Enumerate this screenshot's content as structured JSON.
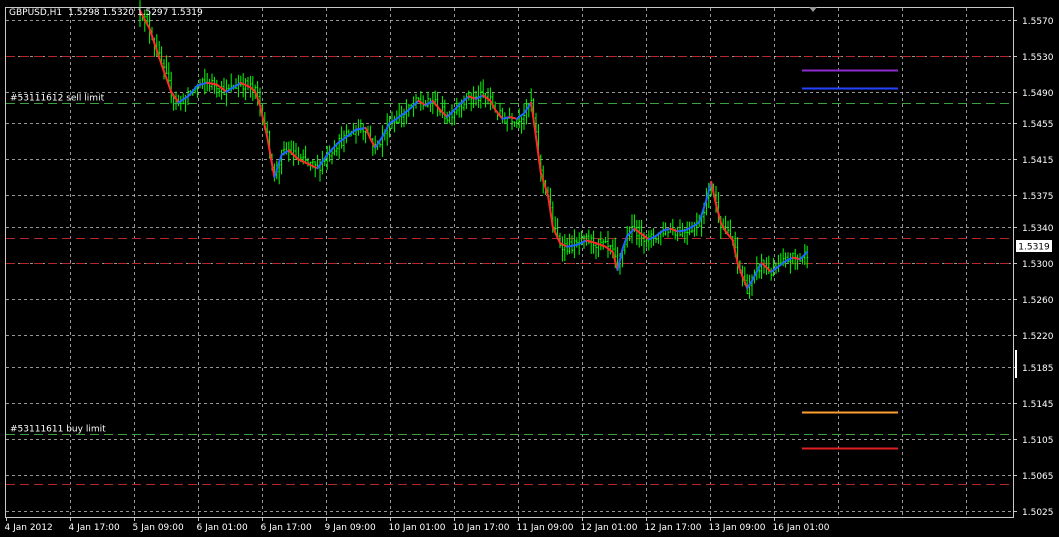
{
  "header": {
    "symbol_tf": "GBPUSD,H1",
    "ohlc": "1.5298 1.5320 1.5297 1.5319"
  },
  "current_price_label": "1.5319",
  "colors": {
    "background": "#000000",
    "grid": "#c8c8c8",
    "bull": "#00ff00",
    "bear": "#00ff00",
    "red_line": "#ff2a2a",
    "blue_line": "#1e64ff",
    "green_dash": "#3ca03c",
    "red_dash": "#b42828",
    "purple_seg": "#8e2bd0",
    "blue_seg": "#2244ff",
    "orange_seg": "#ff9e30",
    "red_seg": "#e02020"
  },
  "orders": [
    {
      "label": "#53111612 sell limit",
      "price": 1.5478,
      "color": "#3ca03c"
    },
    {
      "label": "#53111611 buy limit",
      "price": 1.511,
      "color": "#3ca03c"
    }
  ],
  "chart_data": {
    "type": "candlestick",
    "price_ticks": [
      "1.5570",
      "1.5530",
      "1.5490",
      "1.5455",
      "1.5415",
      "1.5375",
      "1.5340",
      "1.5300",
      "1.5260",
      "1.5220",
      "1.5185",
      "1.5145",
      "1.5105",
      "1.5065",
      "1.5025"
    ],
    "time_ticks": [
      "4 Jan 2012",
      "4 Jan 17:00",
      "5 Jan 09:00",
      "6 Jan 01:00",
      "6 Jan 17:00",
      "9 Jan 09:00",
      "10 Jan 01:00",
      "10 Jan 17:00",
      "11 Jan 09:00",
      "12 Jan 01:00",
      "12 Jan 17:00",
      "13 Jan 09:00",
      "16 Jan 01:00"
    ],
    "ylim": [
      1.5018,
      1.5583
    ],
    "red_dashed_levels": [
      1.553,
      1.5328,
      1.53,
      1.5055
    ],
    "level_segments": [
      {
        "price": 1.5514,
        "color": "#8e2bd0"
      },
      {
        "price": 1.5494,
        "color": "#2244ff"
      },
      {
        "price": 1.5135,
        "color": "#ff9e30"
      },
      {
        "price": 1.5095,
        "color": "#e02020"
      }
    ],
    "path_points": [
      [
        0,
        1.558
      ],
      [
        4,
        1.556
      ],
      [
        9,
        1.552
      ],
      [
        13,
        1.549
      ],
      [
        16,
        1.5478
      ],
      [
        20,
        1.5485
      ],
      [
        24,
        1.5497
      ],
      [
        28,
        1.55
      ],
      [
        32,
        1.5498
      ],
      [
        36,
        1.549
      ],
      [
        39,
        1.5495
      ],
      [
        42,
        1.55
      ],
      [
        46,
        1.5495
      ],
      [
        48,
        1.549
      ],
      [
        50,
        1.5475
      ],
      [
        53,
        1.544
      ],
      [
        56,
        1.5395
      ],
      [
        59,
        1.542
      ],
      [
        62,
        1.5425
      ],
      [
        66,
        1.5415
      ],
      [
        70,
        1.541
      ],
      [
        74,
        1.5405
      ],
      [
        78,
        1.542
      ],
      [
        82,
        1.5432
      ],
      [
        86,
        1.544
      ],
      [
        90,
        1.5448
      ],
      [
        94,
        1.545
      ],
      [
        96,
        1.5438
      ],
      [
        98,
        1.5428
      ],
      [
        101,
        1.544
      ],
      [
        104,
        1.5455
      ],
      [
        108,
        1.5462
      ],
      [
        112,
        1.547
      ],
      [
        116,
        1.548
      ],
      [
        119,
        1.5475
      ],
      [
        122,
        1.548
      ],
      [
        125,
        1.547
      ],
      [
        128,
        1.5462
      ],
      [
        131,
        1.547
      ],
      [
        134,
        1.5478
      ],
      [
        137,
        1.5485
      ],
      [
        140,
        1.5482
      ],
      [
        143,
        1.5486
      ],
      [
        146,
        1.548
      ],
      [
        148,
        1.547
      ],
      [
        151,
        1.546
      ],
      [
        154,
        1.5462
      ],
      [
        157,
        1.546
      ],
      [
        160,
        1.5466
      ],
      [
        163,
        1.5478
      ],
      [
        165,
        1.544
      ],
      [
        167,
        1.54
      ],
      [
        170,
        1.5375
      ],
      [
        172,
        1.534
      ],
      [
        175,
        1.5322
      ],
      [
        178,
        1.5318
      ],
      [
        182,
        1.532
      ],
      [
        186,
        1.5325
      ],
      [
        190,
        1.5322
      ],
      [
        194,
        1.5318
      ],
      [
        197,
        1.5312
      ],
      [
        199,
        1.5292
      ],
      [
        201,
        1.5315
      ],
      [
        203,
        1.533
      ],
      [
        206,
        1.5338
      ],
      [
        209,
        1.5332
      ],
      [
        212,
        1.5326
      ],
      [
        215,
        1.533
      ],
      [
        218,
        1.5336
      ],
      [
        221,
        1.5338
      ],
      [
        224,
        1.5335
      ],
      [
        227,
        1.5336
      ],
      [
        230,
        1.534
      ],
      [
        233,
        1.5345
      ],
      [
        236,
        1.537
      ],
      [
        238,
        1.539
      ],
      [
        240,
        1.5365
      ],
      [
        242,
        1.5345
      ],
      [
        244,
        1.5335
      ],
      [
        247,
        1.5325
      ],
      [
        249,
        1.53
      ],
      [
        251,
        1.5285
      ],
      [
        253,
        1.5272
      ],
      [
        255,
        1.528
      ],
      [
        257,
        1.529
      ],
      [
        259,
        1.53
      ],
      [
        261,
        1.5295
      ],
      [
        263,
        1.529
      ],
      [
        266,
        1.5296
      ],
      [
        269,
        1.5302
      ],
      [
        272,
        1.5306
      ],
      [
        275,
        1.5304
      ],
      [
        278,
        1.5312
      ]
    ]
  }
}
